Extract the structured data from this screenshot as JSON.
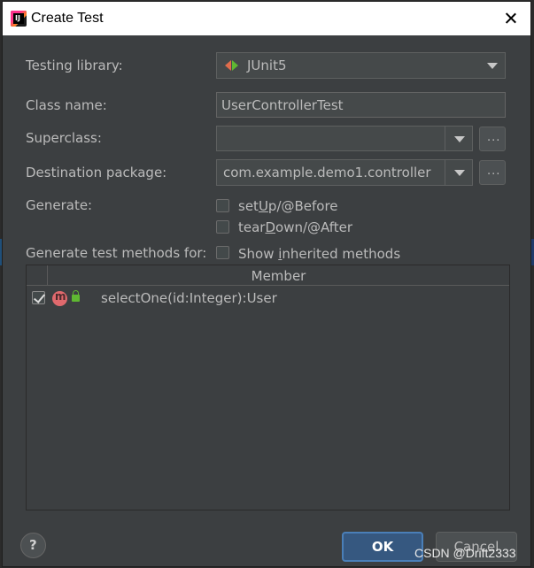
{
  "dialog": {
    "title": "Create Test"
  },
  "form": {
    "testing_library_label": "Testing library:",
    "testing_library_value": "JUnit5",
    "class_name_label": "Class name:",
    "class_name_value": "UserControllerTest",
    "superclass_label": "Superclass:",
    "superclass_value": "",
    "destination_package_label": "Destination package:",
    "destination_package_value": "com.example.demo1.controller",
    "browse_label": "...",
    "generate_label": "Generate:",
    "setup_prefix": "set",
    "setup_mnemonic": "U",
    "setup_suffix": "p/@Before",
    "teardown_prefix": "tear",
    "teardown_mnemonic": "D",
    "teardown_suffix": "own/@After",
    "generate_methods_label": "Generate test methods for:",
    "show_inherited_prefix": "Show ",
    "show_inherited_mnemonic": "i",
    "show_inherited_suffix": "nherited methods"
  },
  "table": {
    "column_member": "Member",
    "rows": [
      {
        "checked": true,
        "icon_letter": "m",
        "member": "selectOne(id:Integer):User"
      }
    ]
  },
  "buttons": {
    "help": "?",
    "ok": "OK",
    "cancel": "Cancel"
  },
  "watermark": "CSDN @Drift2333",
  "colors": {
    "dialog_bg": "#3c3f41",
    "field_bg": "#45494a",
    "accent_ok": "#365880",
    "method_icon": "#e0696d",
    "access_icon": "#5fb832"
  }
}
